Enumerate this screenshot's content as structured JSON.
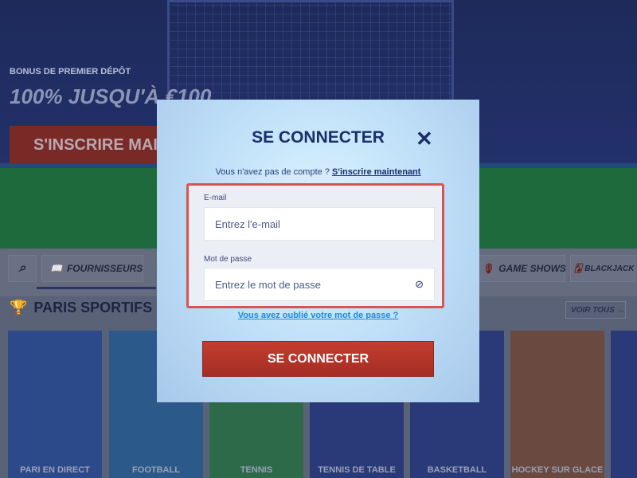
{
  "banner": {
    "bonus_small": "BONUS DE PREMIER DÉPÔT",
    "bonus_big": "100% JUSQU'À €100",
    "signup": "S'INSCRIRE MAINTENANT"
  },
  "nav": {
    "items": [
      {
        "label": "FOURNISSEURS",
        "icon": "book-icon"
      },
      {
        "label": "GAME SHOWS",
        "icon": "microphone-icon"
      },
      {
        "label": "BLACKJACK",
        "icon": "cards-icon"
      }
    ]
  },
  "section": {
    "title": "PARIS SPORTIFS",
    "voir_tous": "VOIR TOUS →"
  },
  "cards": [
    "PARI EN DIRECT",
    "FOOTBALL",
    "TENNIS",
    "TENNIS DE TABLE",
    "BASKETBALL",
    "HOCKEY SUR GLACE"
  ],
  "modal": {
    "title": "SE CONNECTER",
    "no_account": "Vous n'avez pas de compte ?",
    "signup_link": "S'inscrire maintenant",
    "email_label": "E-mail",
    "email_placeholder": "Entrez l'e-mail",
    "password_label": "Mot de passe",
    "password_placeholder": "Entrez le mot de passe",
    "forgot": "Vous avez oublié votre mot de passe ?",
    "submit": "SE CONNECTER"
  },
  "colors": {
    "primary": "#1a2d6b",
    "accent_red": "#c43d2e",
    "link": "#1a8ae0",
    "highlight_border": "#d9534f"
  }
}
